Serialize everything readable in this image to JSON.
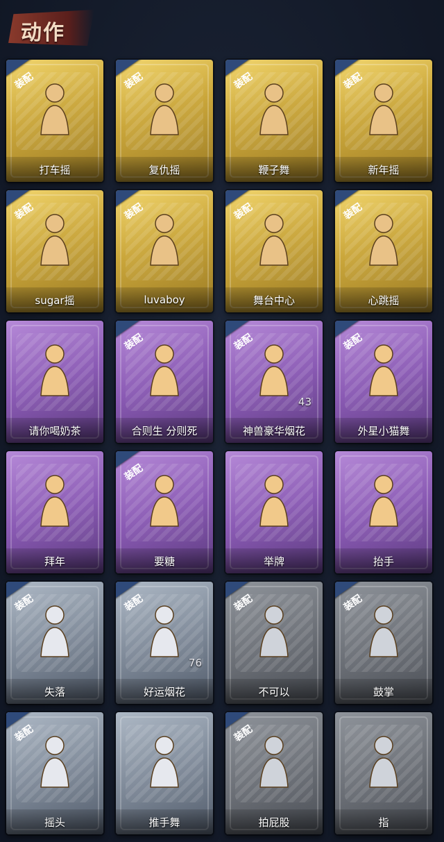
{
  "header": {
    "title": "动作"
  },
  "equip_label": "装配",
  "icon_colors": {
    "gold": "#e9c287",
    "purple": "#f1c98a",
    "silver": "#e6e8ee",
    "gray": "#cfd3da"
  },
  "items": [
    {
      "label": "打车摇",
      "theme": "gold",
      "equipped": true,
      "icon": "dancer-hip-icon"
    },
    {
      "label": "复仇摇",
      "theme": "gold",
      "equipped": true,
      "icon": "dancer-point-up-icon"
    },
    {
      "label": "鞭子舞",
      "theme": "gold",
      "equipped": true,
      "icon": "dancer-whip-icon"
    },
    {
      "label": "新年摇",
      "theme": "gold",
      "equipped": true,
      "icon": "dancer-newyear-icon"
    },
    {
      "label": "sugar摇",
      "theme": "gold",
      "equipped": true,
      "icon": "dancer-sugar-icon"
    },
    {
      "label": "luvaboy",
      "theme": "gold",
      "equipped": true,
      "icon": "dancer-hug-icon"
    },
    {
      "label": "舞台中心",
      "theme": "gold",
      "equipped": true,
      "icon": "dancer-center-icon"
    },
    {
      "label": "心跳摇",
      "theme": "gold",
      "equipped": true,
      "icon": "dancer-heartbeat-icon"
    },
    {
      "label": "请你喝奶茶",
      "theme": "purple",
      "equipped": false,
      "icon": "milk-tea-icon"
    },
    {
      "label": "合则生 分则死",
      "theme": "purple",
      "equipped": true,
      "icon": "group-hug-icon"
    },
    {
      "label": "神兽豪华烟花",
      "theme": "purple",
      "equipped": true,
      "icon": "fireworks-luxury-icon",
      "count": "43"
    },
    {
      "label": "外星小猫舞",
      "theme": "purple",
      "equipped": true,
      "icon": "alien-cat-dance-icon"
    },
    {
      "label": "拜年",
      "theme": "purple",
      "equipped": false,
      "icon": "new-year-greeting-icon"
    },
    {
      "label": "要糖",
      "theme": "purple",
      "equipped": true,
      "icon": "ask-candy-icon"
    },
    {
      "label": "举牌",
      "theme": "purple",
      "equipped": false,
      "icon": "hold-sign-icon"
    },
    {
      "label": "抬手",
      "theme": "purple",
      "equipped": false,
      "icon": "raise-hand-icon"
    },
    {
      "label": "失落",
      "theme": "silver",
      "equipped": true,
      "icon": "crawl-sad-icon"
    },
    {
      "label": "好运烟花",
      "theme": "silver",
      "equipped": true,
      "icon": "lucky-firework-icon",
      "count": "76"
    },
    {
      "label": "不可以",
      "theme": "gray",
      "equipped": true,
      "icon": "finger-no-icon"
    },
    {
      "label": "鼓掌",
      "theme": "gray",
      "equipped": true,
      "icon": "clap-icon"
    },
    {
      "label": "摇头",
      "theme": "silver",
      "equipped": true,
      "icon": "shake-head-icon"
    },
    {
      "label": "推手舞",
      "theme": "silver",
      "equipped": false,
      "icon": "push-hand-dance-icon"
    },
    {
      "label": "拍屁股",
      "theme": "gray",
      "equipped": true,
      "icon": "pat-butt-icon"
    },
    {
      "label": "指",
      "theme": "gray",
      "equipped": false,
      "icon": "point-icon"
    }
  ]
}
